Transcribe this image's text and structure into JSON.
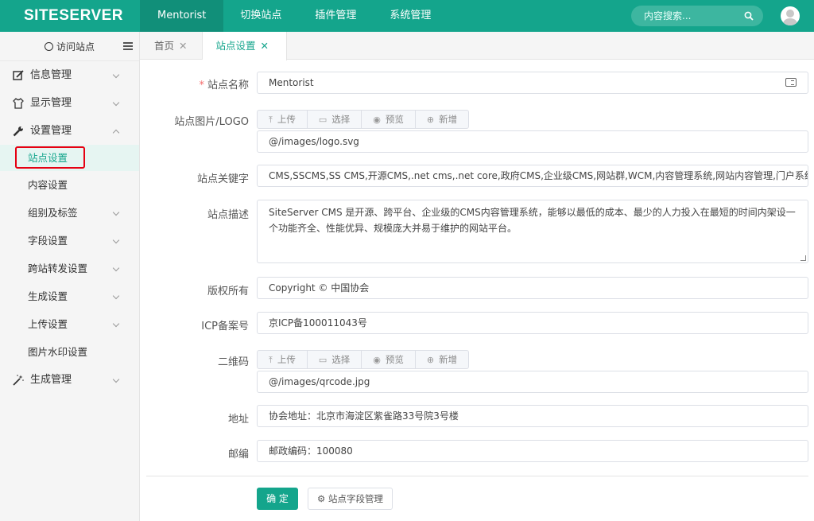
{
  "header": {
    "logo": "SITESERVER",
    "nav": [
      "Mentorist",
      "切换站点",
      "插件管理",
      "系统管理"
    ],
    "search_placeholder": "内容搜索..."
  },
  "sidebar": {
    "visit_label": "访问站点",
    "items": [
      {
        "label": "信息管理",
        "icon": "edit-icon"
      },
      {
        "label": "显示管理",
        "icon": "shirt-icon"
      },
      {
        "label": "设置管理",
        "icon": "wrench-icon"
      },
      {
        "label": "站点设置"
      },
      {
        "label": "内容设置"
      },
      {
        "label": "组别及标签"
      },
      {
        "label": "字段设置"
      },
      {
        "label": "跨站转发设置"
      },
      {
        "label": "生成设置"
      },
      {
        "label": "上传设置"
      },
      {
        "label": "图片水印设置"
      },
      {
        "label": "生成管理",
        "icon": "magic-wand-icon"
      }
    ]
  },
  "tabs": [
    {
      "label": "首页"
    },
    {
      "label": "站点设置"
    }
  ],
  "form": {
    "site_name_label": "站点名称",
    "site_name_value": "Mentorist",
    "logo_label": "站点图片/LOGO",
    "upload_buttons": [
      "上传",
      "选择",
      "预览",
      "新增"
    ],
    "logo_value": "@/images/logo.svg",
    "keywords_label": "站点关键字",
    "keywords_value": "CMS,SSCMS,SS CMS,开源CMS,.net cms,.net core,政府CMS,企业级CMS,网站群,WCM,内容管理系统,网站内容管理,门户系统,建站系统",
    "desc_label": "站点描述",
    "desc_value": "SiteServer CMS 是开源、跨平台、企业级的CMS内容管理系统，能够以最低的成本、最少的人力投入在最短的时间内架设一个功能齐全、性能优异、规模庞大并易于维护的网站平台。",
    "copyright_label": "版权所有",
    "copyright_value": "Copyright © 中国协会",
    "icp_label": "ICP备案号",
    "icp_value": "京ICP备100011043号",
    "qrcode_label": "二维码",
    "qrcode_value": "@/images/qrcode.jpg",
    "address_label": "地址",
    "address_value": "协会地址：北京市海淀区紫雀路33号院3号楼",
    "zip_label": "邮编",
    "zip_value": "邮政编码：100080",
    "ok_button": "确 定",
    "field_button": "站点字段管理"
  },
  "colors": {
    "brand": "#14a58c",
    "highlight": "#e60012"
  }
}
